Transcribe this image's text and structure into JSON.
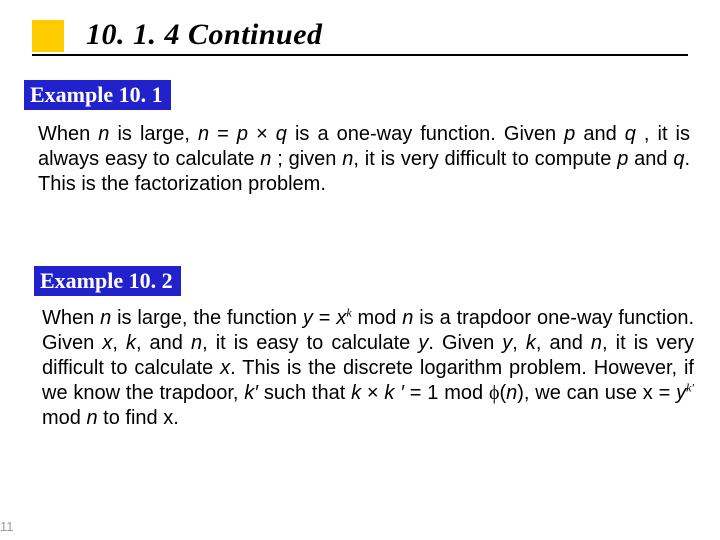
{
  "header": {
    "title": "10. 1. 4  Continued"
  },
  "example1": {
    "label": "Example 10. 1",
    "text_html": "When <i>n</i> is large, <i>n</i> = <i>p</i> × <i>q</i> is a one-way function. Given <i>p</i> and <i>q</i> , it is always easy to calculate <i>n</i> ; given <i>n</i>, it is very difficult to compute <i>p</i> and <i>q</i>. This is the factorization problem."
  },
  "example2": {
    "label": "Example 10. 2",
    "text_html": "When <i>n</i> is large, the function <i>y</i> = <i>x</i><span class='k-sup'>k</span> mod <i>n</i> is a trapdoor one-way function. Given <i>x</i>, <i>k</i>, and <i>n</i>, it is easy to calculate <i>y</i>. Given <i>y</i>, <i>k</i>, and <i>n</i>, it is very difficult to calculate <i>x</i>. This is the discrete logarithm problem. However, if we know the trapdoor, <i>k′</i> such that <i>k</i> × <i>k ′</i> = 1 mod <span style='font-family:Symbol,serif'>ϕ</span>(<i>n</i>), we can use x = <i>y</i><span class='k-sup'>k'</span> mod <i>n</i> to find x."
  },
  "page_number": "11"
}
